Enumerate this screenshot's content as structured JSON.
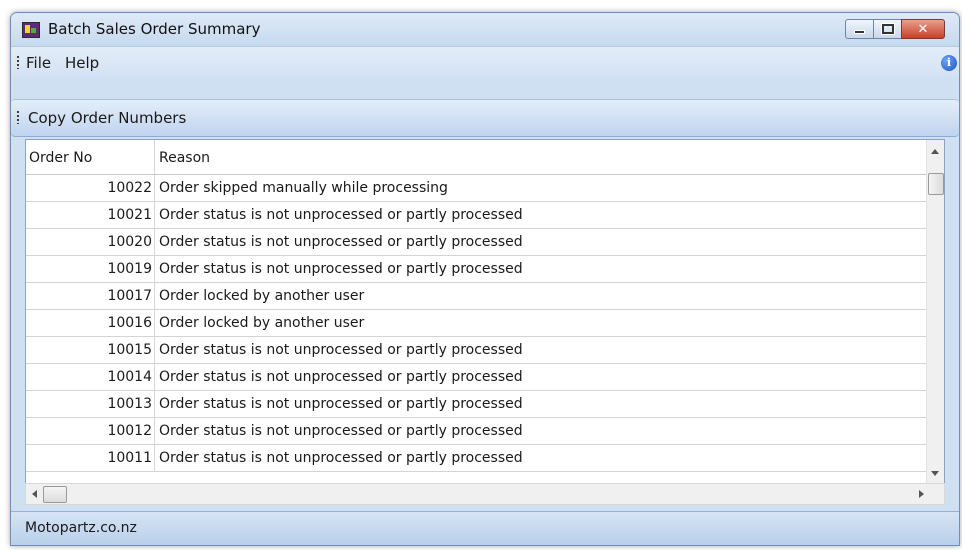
{
  "window": {
    "title": "Batch Sales Order Summary",
    "close_glyph": "✕"
  },
  "menubar": {
    "items": [
      "File",
      "Help"
    ],
    "info_icon": "i"
  },
  "toolbar": {
    "copy_label": "Copy Order Numbers"
  },
  "grid": {
    "columns": [
      "Order No",
      "Reason"
    ],
    "rows": [
      {
        "order_no": "10022",
        "reason": "Order skipped manually while processing"
      },
      {
        "order_no": "10021",
        "reason": "Order status is not unprocessed or partly processed"
      },
      {
        "order_no": "10020",
        "reason": "Order status is not unprocessed or partly processed"
      },
      {
        "order_no": "10019",
        "reason": "Order status is not unprocessed or partly processed"
      },
      {
        "order_no": "10017",
        "reason": "Order locked by another user"
      },
      {
        "order_no": "10016",
        "reason": "Order locked by another user"
      },
      {
        "order_no": "10015",
        "reason": "Order status is not unprocessed or partly processed"
      },
      {
        "order_no": "10014",
        "reason": "Order status is not unprocessed or partly processed"
      },
      {
        "order_no": "10013",
        "reason": "Order status is not unprocessed or partly processed"
      },
      {
        "order_no": "10012",
        "reason": "Order status is not unprocessed or partly processed"
      },
      {
        "order_no": "10011",
        "reason": "Order status is not unprocessed or partly processed"
      }
    ]
  },
  "statusbar": {
    "text": "Motopartz.co.nz"
  },
  "colors": {
    "window_bg": "#cfe0f3",
    "close_button": "#c8412a",
    "info_icon": "#1a53c2"
  }
}
